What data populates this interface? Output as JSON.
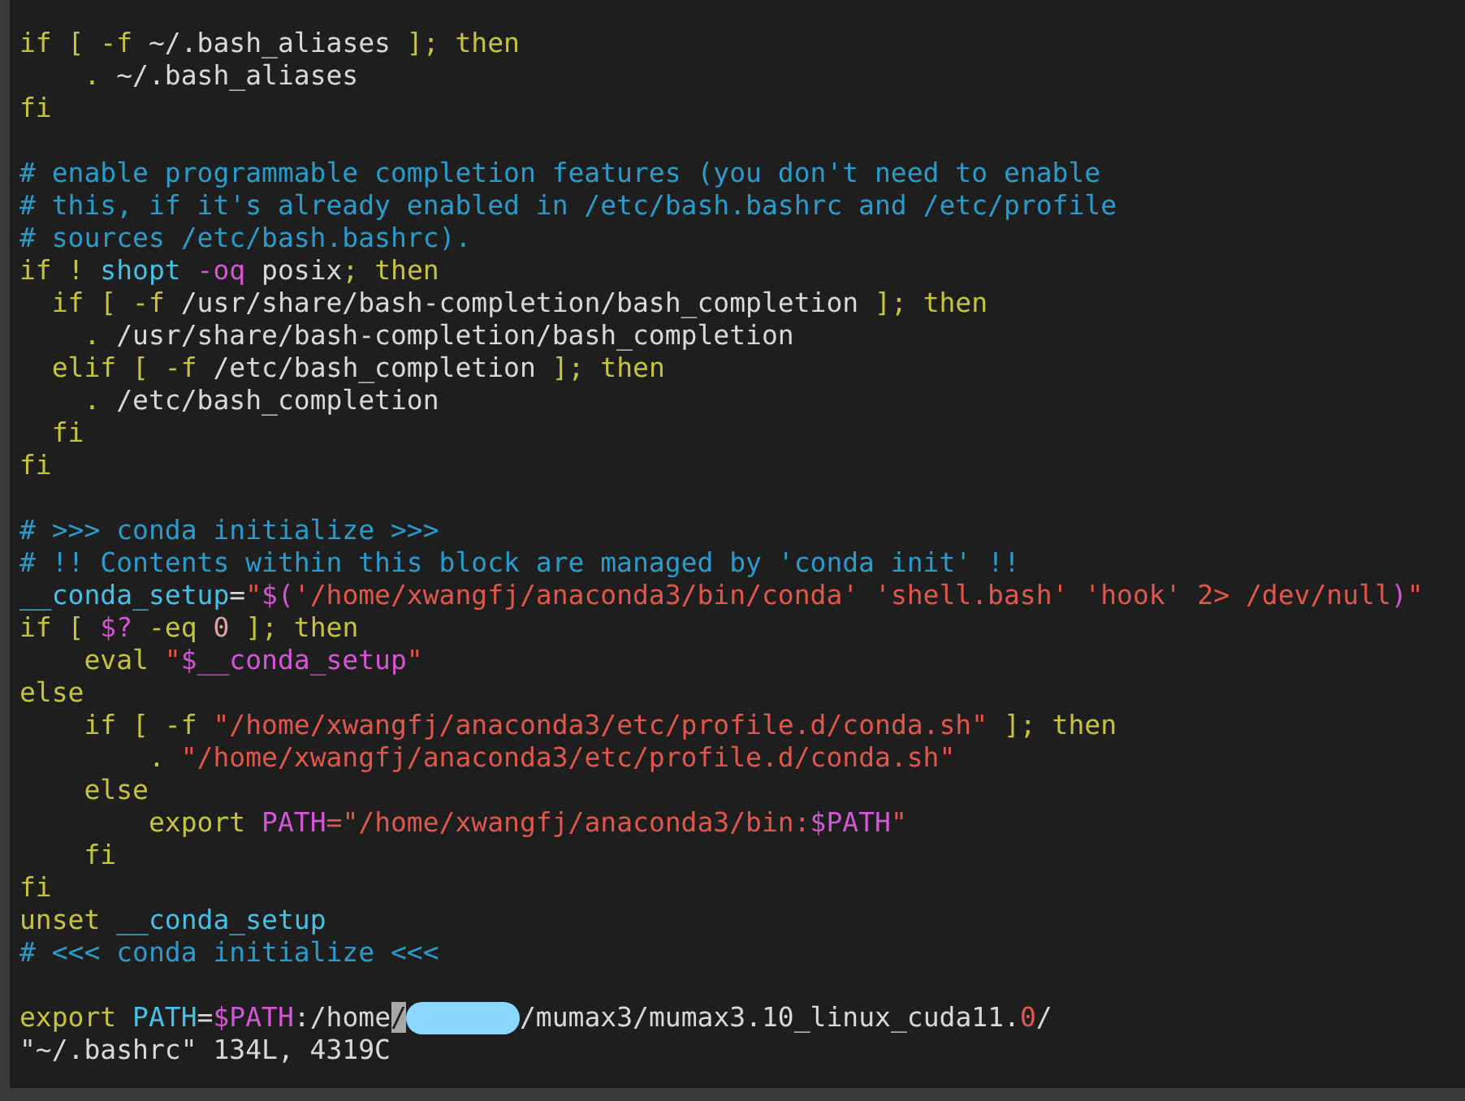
{
  "editor": {
    "lines": [
      {
        "kind": "code",
        "segments": [
          {
            "kind": "keyword",
            "text": "if [ -f "
          },
          {
            "kind": "plain",
            "text": "~/.bash_aliases"
          },
          {
            "kind": "keyword",
            "text": " ]; then"
          }
        ]
      },
      {
        "kind": "code",
        "segments": [
          {
            "kind": "keyword",
            "text": "    . "
          },
          {
            "kind": "plain",
            "text": "~/.bash_aliases"
          }
        ]
      },
      {
        "kind": "code",
        "segments": [
          {
            "kind": "keyword",
            "text": "fi"
          }
        ]
      },
      {
        "kind": "blank"
      },
      {
        "kind": "code",
        "segments": [
          {
            "kind": "comment",
            "text": "# enable programmable completion features (you don't need to enable"
          }
        ]
      },
      {
        "kind": "code",
        "segments": [
          {
            "kind": "comment",
            "text": "# this, if it's already enabled in /etc/bash.bashrc and /etc/profile"
          }
        ]
      },
      {
        "kind": "code",
        "segments": [
          {
            "kind": "comment",
            "text": "# sources /etc/bash.bashrc)."
          }
        ]
      },
      {
        "kind": "code",
        "segments": [
          {
            "kind": "keyword",
            "text": "if ! "
          },
          {
            "kind": "identifier",
            "text": "shopt "
          },
          {
            "kind": "special",
            "text": "-oq"
          },
          {
            "kind": "plain",
            "text": " posix"
          },
          {
            "kind": "keyword",
            "text": "; then"
          }
        ]
      },
      {
        "kind": "code",
        "segments": [
          {
            "kind": "keyword",
            "text": "  if [ -f "
          },
          {
            "kind": "plain",
            "text": "/usr/share/bash-completion/bash_completion"
          },
          {
            "kind": "keyword",
            "text": " ]; then"
          }
        ]
      },
      {
        "kind": "code",
        "segments": [
          {
            "kind": "keyword",
            "text": "    . "
          },
          {
            "kind": "plain",
            "text": "/usr/share/bash-completion/bash_completion"
          }
        ]
      },
      {
        "kind": "code",
        "segments": [
          {
            "kind": "keyword",
            "text": "  elif [ -f "
          },
          {
            "kind": "plain",
            "text": "/etc/bash_completion"
          },
          {
            "kind": "keyword",
            "text": " ]; then"
          }
        ]
      },
      {
        "kind": "code",
        "segments": [
          {
            "kind": "keyword",
            "text": "    . "
          },
          {
            "kind": "plain",
            "text": "/etc/bash_completion"
          }
        ]
      },
      {
        "kind": "code",
        "segments": [
          {
            "kind": "keyword",
            "text": "  fi"
          }
        ]
      },
      {
        "kind": "code",
        "segments": [
          {
            "kind": "keyword",
            "text": "fi"
          }
        ]
      },
      {
        "kind": "blank"
      },
      {
        "kind": "code",
        "segments": [
          {
            "kind": "comment",
            "text": "# >>> conda initialize >>>"
          }
        ]
      },
      {
        "kind": "code",
        "segments": [
          {
            "kind": "comment",
            "text": "# !! Contents within this block are managed by 'conda init' !!"
          }
        ]
      },
      {
        "kind": "code",
        "segments": [
          {
            "kind": "identifier",
            "text": "__conda_setup"
          },
          {
            "kind": "plain",
            "text": "="
          },
          {
            "kind": "string",
            "text": "\""
          },
          {
            "kind": "special",
            "text": "$("
          },
          {
            "kind": "string",
            "text": "'/home/xwangfj/anaconda3/bin/conda' 'shell.bash' 'hook' 2> /dev/null"
          },
          {
            "kind": "special",
            "text": ")"
          },
          {
            "kind": "string",
            "text": "\""
          }
        ]
      },
      {
        "kind": "code",
        "segments": [
          {
            "kind": "keyword",
            "text": "if [ "
          },
          {
            "kind": "special",
            "text": "$?"
          },
          {
            "kind": "keyword",
            "text": " -eq "
          },
          {
            "kind": "number",
            "text": "0"
          },
          {
            "kind": "keyword",
            "text": " ]; then"
          }
        ]
      },
      {
        "kind": "code",
        "segments": [
          {
            "kind": "keyword",
            "text": "    eval "
          },
          {
            "kind": "string",
            "text": "\""
          },
          {
            "kind": "special",
            "text": "$__conda_setup"
          },
          {
            "kind": "string",
            "text": "\""
          }
        ]
      },
      {
        "kind": "code",
        "segments": [
          {
            "kind": "keyword",
            "text": "else"
          }
        ]
      },
      {
        "kind": "code",
        "segments": [
          {
            "kind": "keyword",
            "text": "    if [ -f "
          },
          {
            "kind": "string",
            "text": "\"/home/xwangfj/anaconda3/etc/profile.d/conda.sh\""
          },
          {
            "kind": "keyword",
            "text": " ]; then"
          }
        ]
      },
      {
        "kind": "code",
        "segments": [
          {
            "kind": "keyword",
            "text": "        . "
          },
          {
            "kind": "string",
            "text": "\"/home/xwangfj/anaconda3/etc/profile.d/conda.sh\""
          }
        ]
      },
      {
        "kind": "code",
        "segments": [
          {
            "kind": "keyword",
            "text": "    else"
          }
        ]
      },
      {
        "kind": "code",
        "segments": [
          {
            "kind": "keyword",
            "text": "        export "
          },
          {
            "kind": "special",
            "text": "PATH"
          },
          {
            "kind": "string",
            "text": "=\"/home/xwangfj/anaconda3/bin:"
          },
          {
            "kind": "special",
            "text": "$PATH"
          },
          {
            "kind": "string",
            "text": "\""
          }
        ]
      },
      {
        "kind": "code",
        "segments": [
          {
            "kind": "keyword",
            "text": "    fi"
          }
        ]
      },
      {
        "kind": "code",
        "segments": [
          {
            "kind": "keyword",
            "text": "fi"
          }
        ]
      },
      {
        "kind": "code",
        "segments": [
          {
            "kind": "keyword",
            "text": "unset "
          },
          {
            "kind": "identifier",
            "text": "__conda_setup"
          }
        ]
      },
      {
        "kind": "code",
        "segments": [
          {
            "kind": "comment",
            "text": "# <<< conda initialize <<<"
          }
        ]
      },
      {
        "kind": "blank"
      },
      {
        "kind": "code",
        "segments": [
          {
            "kind": "keyword",
            "text": "export "
          },
          {
            "kind": "identifier",
            "text": "PATH"
          },
          {
            "kind": "plain",
            "text": "="
          },
          {
            "kind": "special",
            "text": "$PATH"
          },
          {
            "kind": "plain",
            "text": ":/home"
          },
          {
            "kind": "cursor",
            "text": "/"
          },
          {
            "kind": "redaction"
          },
          {
            "kind": "plain",
            "text": "/mumax3/mumax3.10_linux_cuda11."
          },
          {
            "kind": "string",
            "text": "0"
          },
          {
            "kind": "plain",
            "text": "/"
          }
        ]
      }
    ],
    "status_line": "\"~/.bashrc\" 134L, 4319C"
  }
}
